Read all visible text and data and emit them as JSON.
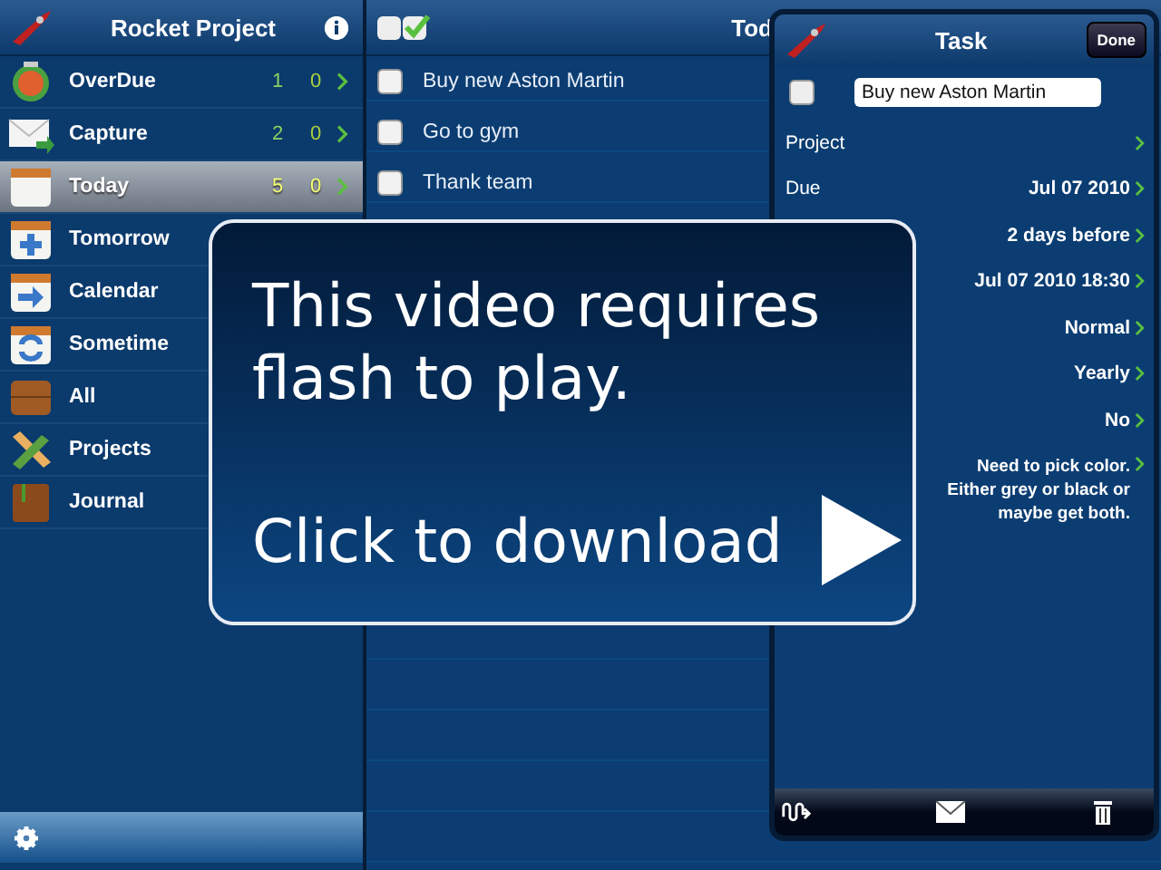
{
  "sidebar": {
    "title": "Rocket Project",
    "items": [
      {
        "label": "OverDue",
        "kind": "alarm-clock",
        "count": "1",
        "count_done": "0",
        "selected": false
      },
      {
        "label": "Capture",
        "kind": "envelope",
        "count": "2",
        "count_done": "0",
        "selected": false
      },
      {
        "label": "Today",
        "kind": "calendar",
        "count": "5",
        "count_done": "0",
        "selected": true
      },
      {
        "label": "Tomorrow",
        "kind": "calendar-plus",
        "selected": false
      },
      {
        "label": "Calendar",
        "kind": "calendar-arrow",
        "selected": false
      },
      {
        "label": "Sometime",
        "kind": "calendar-repeat",
        "selected": false
      },
      {
        "label": "All",
        "kind": "box",
        "selected": false
      },
      {
        "label": "Projects",
        "kind": "pencil-ruler",
        "selected": false
      },
      {
        "label": "Journal",
        "kind": "book",
        "selected": false
      }
    ]
  },
  "list": {
    "title": "Tod",
    "tasks": [
      {
        "title": "Buy new Aston Martin",
        "checked": false
      },
      {
        "title": "Go to gym",
        "checked": false
      },
      {
        "title": "Thank team",
        "checked": false
      }
    ]
  },
  "task": {
    "title": "Task",
    "done_button": "Done",
    "checked": false,
    "name": "Buy new Aston Martin",
    "fields": [
      {
        "label": "Project"
      },
      {
        "label": "Due",
        "value": "Jul 07 2010"
      },
      {
        "value": "2 days before"
      },
      {
        "value": "Jul 07 2010 18:30"
      },
      {
        "value": "Normal"
      },
      {
        "value": "Yearly"
      },
      {
        "value": "No"
      },
      {
        "value": "Need to pick color. Either grey or black or maybe get both."
      }
    ]
  },
  "video_notice": {
    "lines": [
      "This video requires",
      "flash to play."
    ],
    "action": "Click to download"
  }
}
